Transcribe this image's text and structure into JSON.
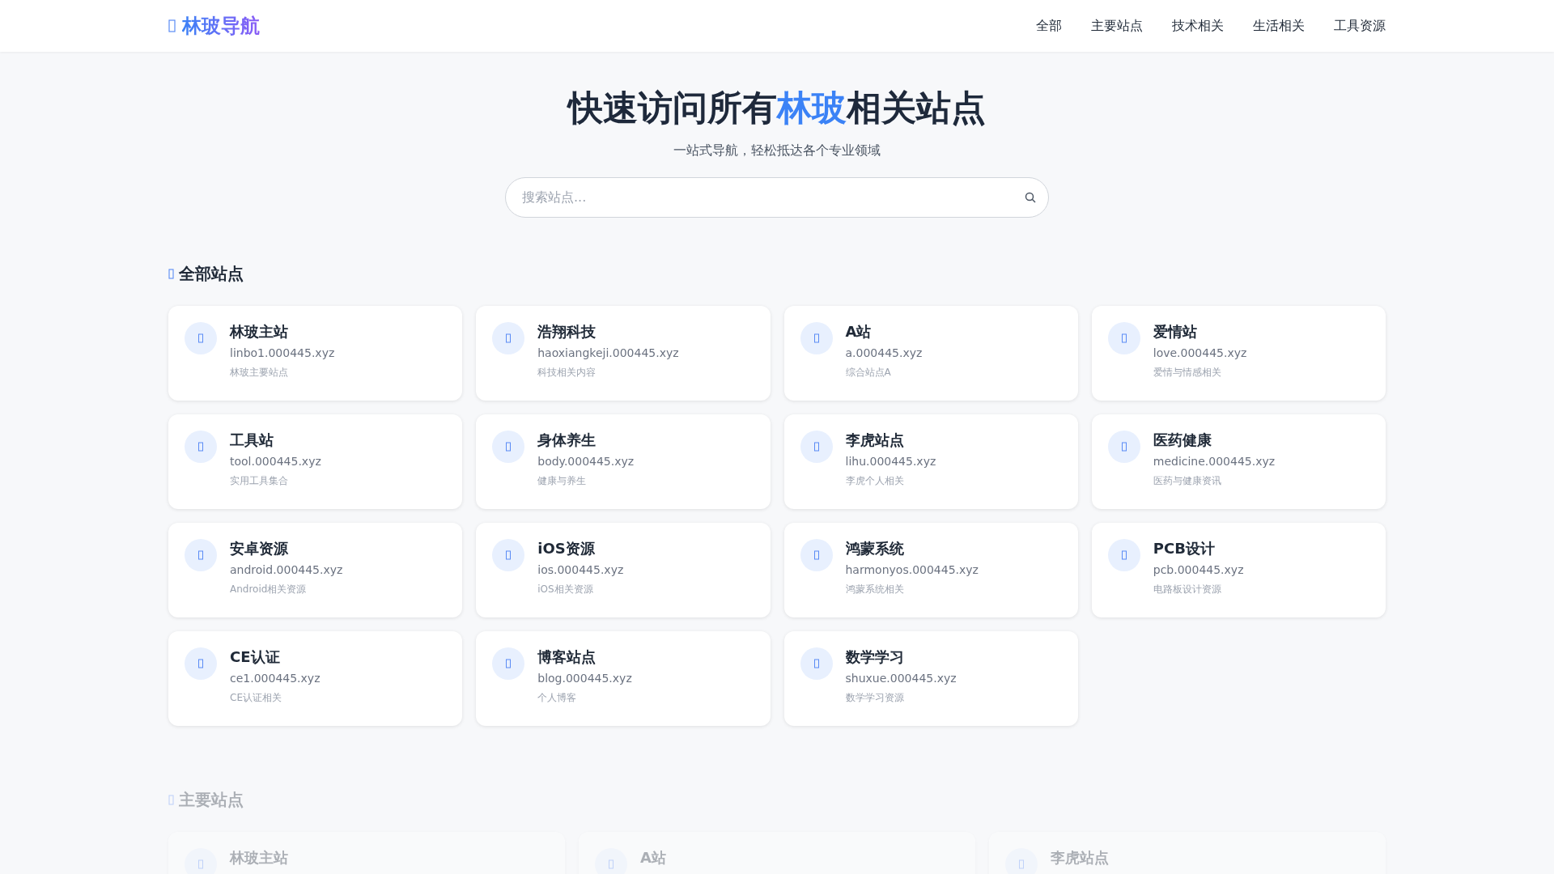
{
  "header": {
    "logo": "林玻导航",
    "nav": [
      {
        "label": "全部"
      },
      {
        "label": "主要站点"
      },
      {
        "label": "技术相关"
      },
      {
        "label": "生活相关"
      },
      {
        "label": "工具资源"
      }
    ]
  },
  "hero": {
    "title_parts": [
      {
        "text": "快速访问所有",
        "highlight": false
      },
      {
        "text": "林玻",
        "highlight": true
      },
      {
        "text": "相关站点",
        "highlight": false
      }
    ],
    "subtitle": "一站式导航，轻松抵达各个专业领域",
    "search": {
      "placeholder": "搜索站点..."
    }
  },
  "sections": [
    {
      "title": "全部站点",
      "kind": "grid",
      "faded": false,
      "sites": [
        {
          "name": "林玻主站",
          "url": "linbo1.000445.xyz",
          "desc": "林玻主要站点"
        },
        {
          "name": "浩翔科技",
          "url": "haoxiangkeji.000445.xyz",
          "desc": "科技相关内容"
        },
        {
          "name": "A站",
          "url": "a.000445.xyz",
          "desc": "综合站点A"
        },
        {
          "name": "爱情站",
          "url": "love.000445.xyz",
          "desc": "爱情与情感相关"
        },
        {
          "name": "工具站",
          "url": "tool.000445.xyz",
          "desc": "实用工具集合"
        },
        {
          "name": "身体养生",
          "url": "body.000445.xyz",
          "desc": "健康与养生"
        },
        {
          "name": "李虎站点",
          "url": "lihu.000445.xyz",
          "desc": "李虎个人相关"
        },
        {
          "name": "医药健康",
          "url": "medicine.000445.xyz",
          "desc": "医药与健康资讯"
        },
        {
          "name": "安卓资源",
          "url": "android.000445.xyz",
          "desc": "Android相关资源"
        },
        {
          "name": "iOS资源",
          "url": "ios.000445.xyz",
          "desc": "iOS相关资源"
        },
        {
          "name": "鸿蒙系统",
          "url": "harmonyos.000445.xyz",
          "desc": "鸿蒙系统相关"
        },
        {
          "name": "PCB设计",
          "url": "pcb.000445.xyz",
          "desc": "电路板设计资源"
        },
        {
          "name": "CE认证",
          "url": "ce1.000445.xyz",
          "desc": "CE认证相关"
        },
        {
          "name": "博客站点",
          "url": "blog.000445.xyz",
          "desc": "个人博客"
        },
        {
          "name": "数学学习",
          "url": "shuxue.000445.xyz",
          "desc": "数学学习资源"
        }
      ]
    },
    {
      "title": "主要站点",
      "kind": "featured",
      "faded": true,
      "sites": [
        {
          "name": "林玻主站"
        },
        {
          "name": "A站"
        },
        {
          "name": "李虎站点"
        }
      ]
    }
  ]
}
